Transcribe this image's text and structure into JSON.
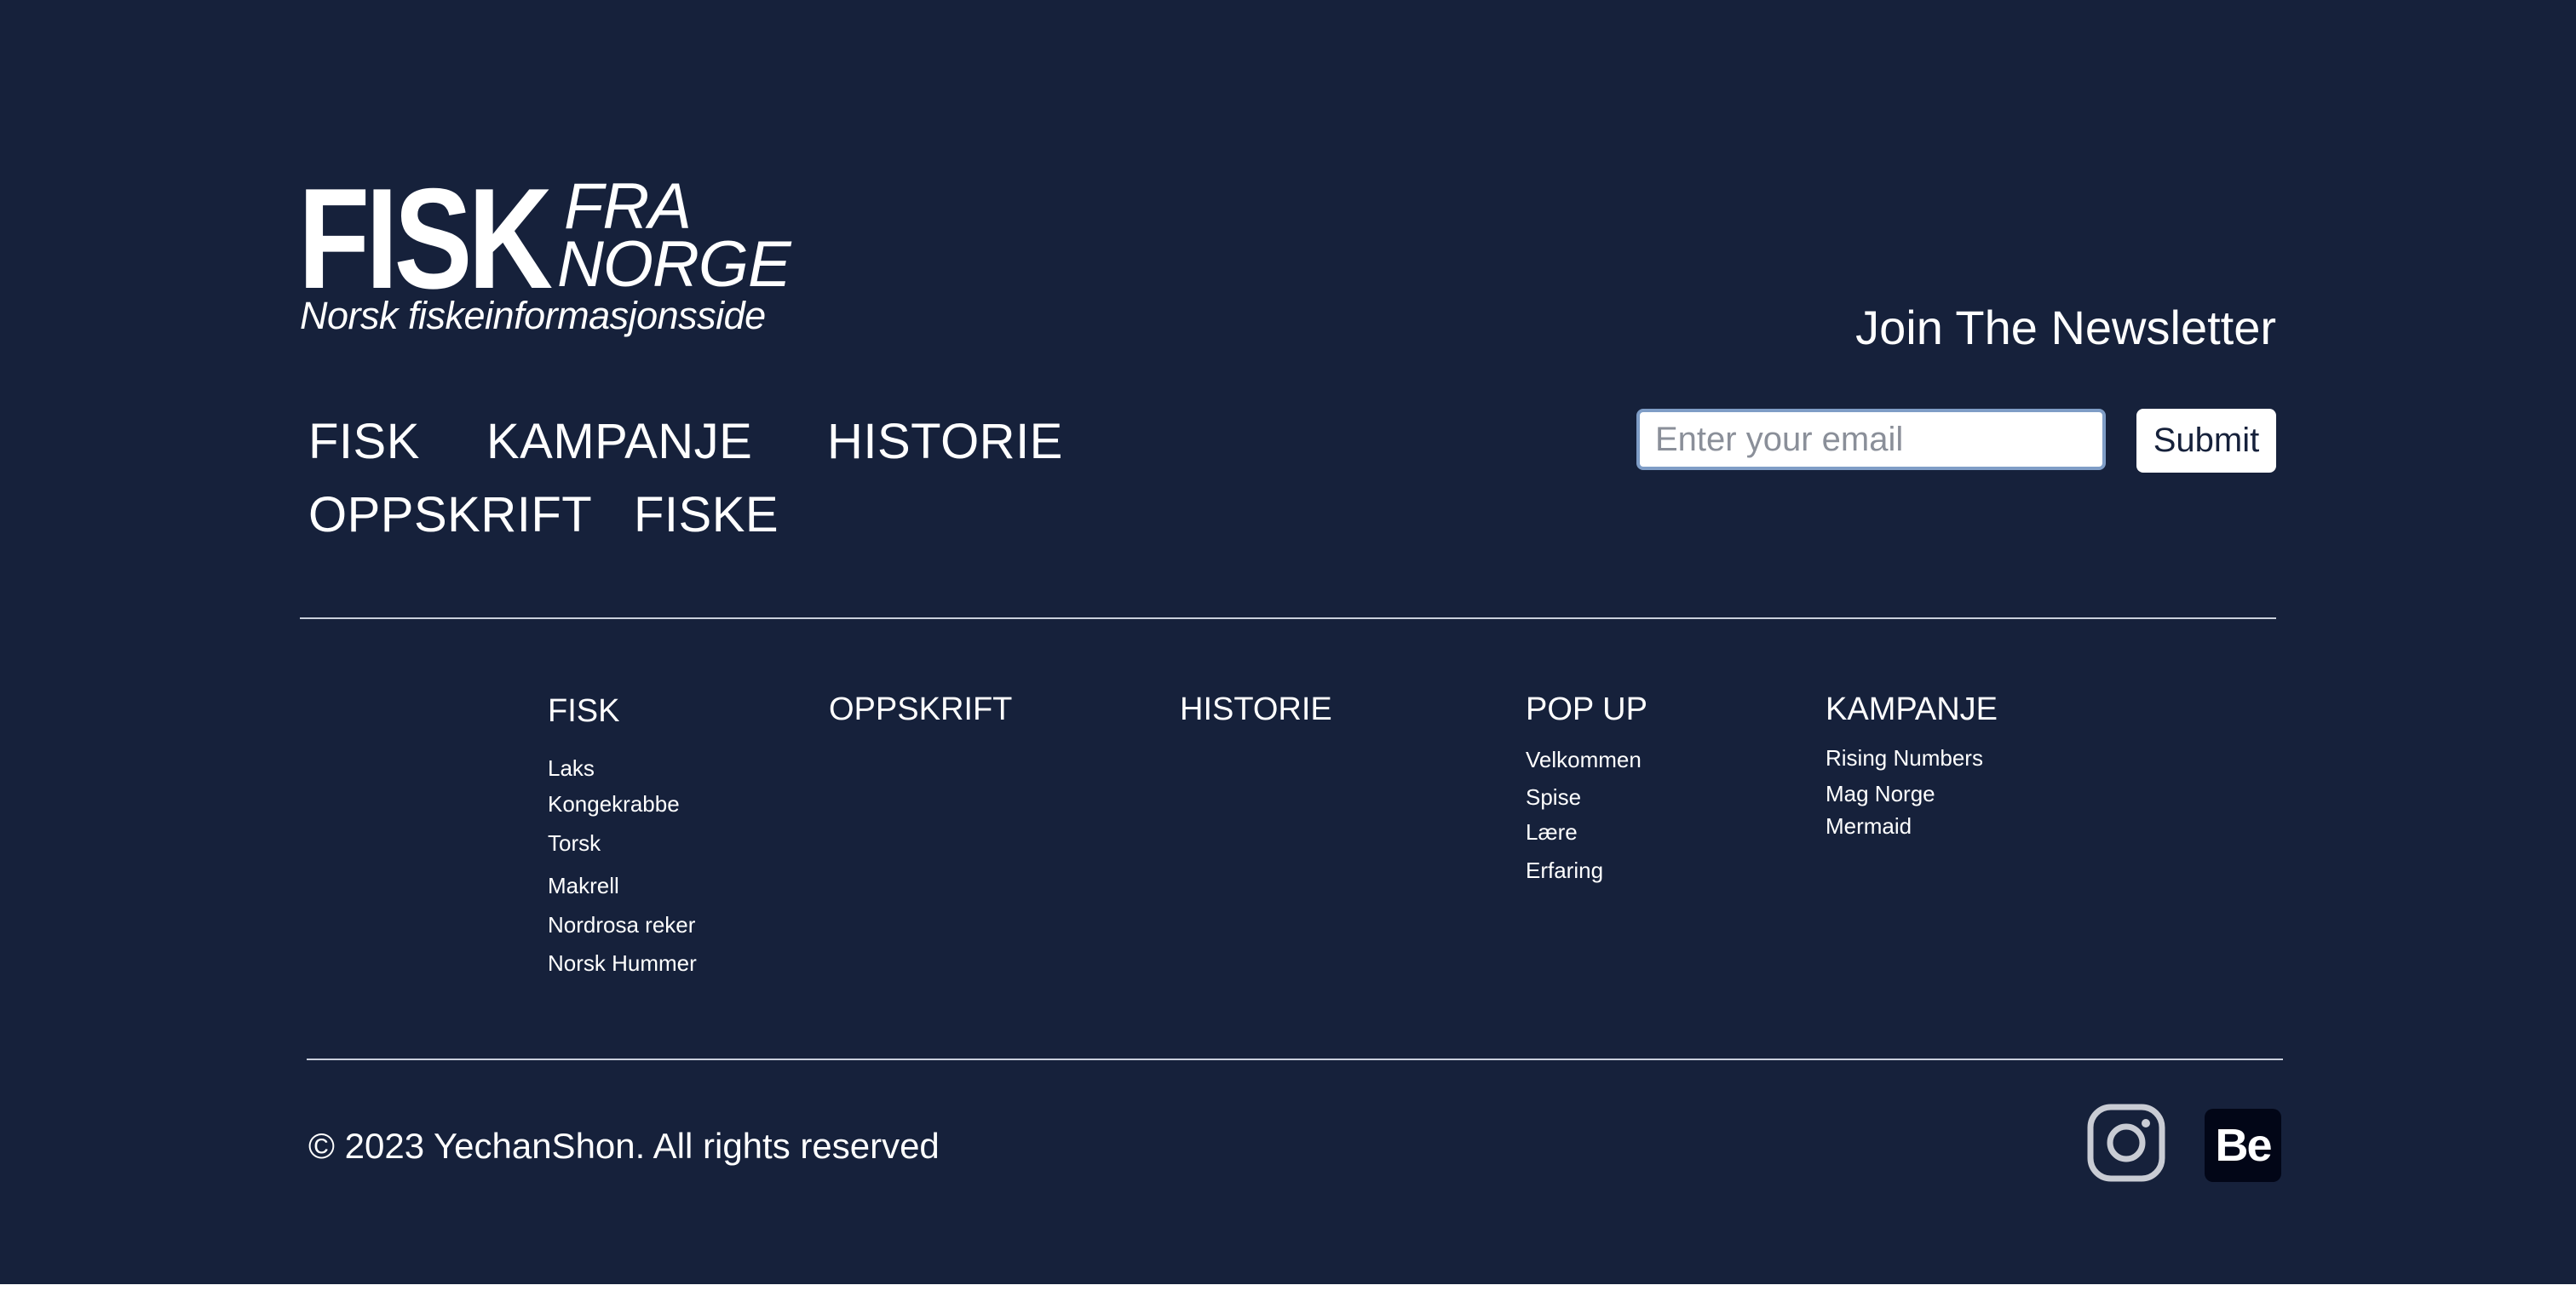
{
  "logo": {
    "word_fisk": "FISK",
    "word_fra": "FRA",
    "word_norge": "NORGE",
    "tagline": "Norsk fiskeinformasjonsside"
  },
  "main_nav": {
    "fisk": "FISK",
    "kampanje": "KAMPANJE",
    "historie": "HISTORIE",
    "oppskrift": "OPPSKRIFT",
    "fiske": "FISKE"
  },
  "newsletter": {
    "title": "Join The Newsletter",
    "email_placeholder": "Enter your email",
    "submit_label": "Submit"
  },
  "sitemap": {
    "fisk": {
      "heading": "FISK",
      "links": [
        "Laks",
        "Kongekrabbe",
        "Torsk",
        "Makrell",
        "Nordrosa reker",
        "Norsk Hummer"
      ]
    },
    "oppskrift": {
      "heading": "OPPSKRIFT"
    },
    "historie": {
      "heading": "HISTORIE"
    },
    "popup": {
      "heading": "POP UP",
      "links": [
        "Velkommen",
        "Spise",
        "Lære",
        "Erfaring"
      ]
    },
    "kampanje": {
      "heading": "KAMPANJE",
      "links": [
        "Rising Numbers",
        "Mag Norge",
        "Mermaid"
      ]
    }
  },
  "footer": {
    "copyright": "© 2023 YechanShon. All rights reserved",
    "behance_label": "Be",
    "icons": [
      "instagram-icon",
      "behance-icon"
    ]
  },
  "colors": {
    "background": "#16213b",
    "text": "#ffffff",
    "divider": "#c9cfdb",
    "input_border": "#7f9dc6",
    "behance_bg": "#020617"
  }
}
